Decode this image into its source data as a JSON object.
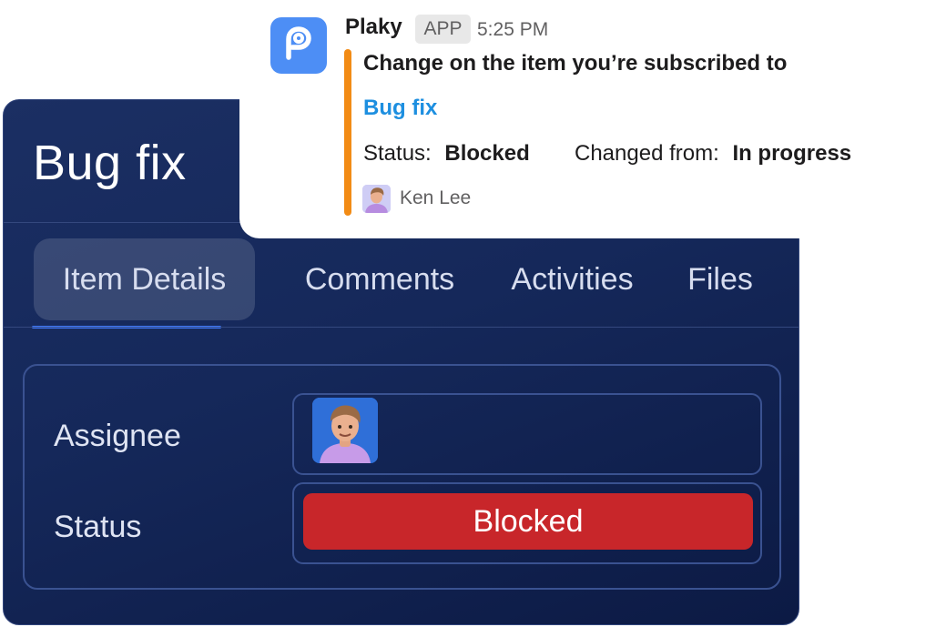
{
  "item": {
    "title": "Bug fix",
    "tabs": [
      {
        "label": "Item Details",
        "active": true
      },
      {
        "label": "Comments",
        "active": false
      },
      {
        "label": "Activities",
        "active": false
      },
      {
        "label": "Files",
        "active": false
      }
    ],
    "fields": {
      "assignee_label": "Assignee",
      "status_label": "Status",
      "status_value": "Blocked"
    }
  },
  "notification": {
    "sender": "Plaky",
    "badge": "APP",
    "time": "5:25 PM",
    "heading": "Change on the item you’re subscribed to",
    "item_link": "Bug fix",
    "status_label": "Status:",
    "status_value": "Blocked",
    "changed_from_label": "Changed from:",
    "changed_from_value": "In progress",
    "author": "Ken Lee"
  },
  "colors": {
    "status_blocked": "#c8262a",
    "accent": "#f28b15",
    "link": "#1d8fe0",
    "app_icon": "#4d8ef5",
    "active_tab_underline": "#3f7bff"
  },
  "icons": {
    "app": "plaky-logo-icon",
    "assignee_avatar": "avatar-3d-man",
    "author_avatar": "avatar-3d-man-small"
  }
}
